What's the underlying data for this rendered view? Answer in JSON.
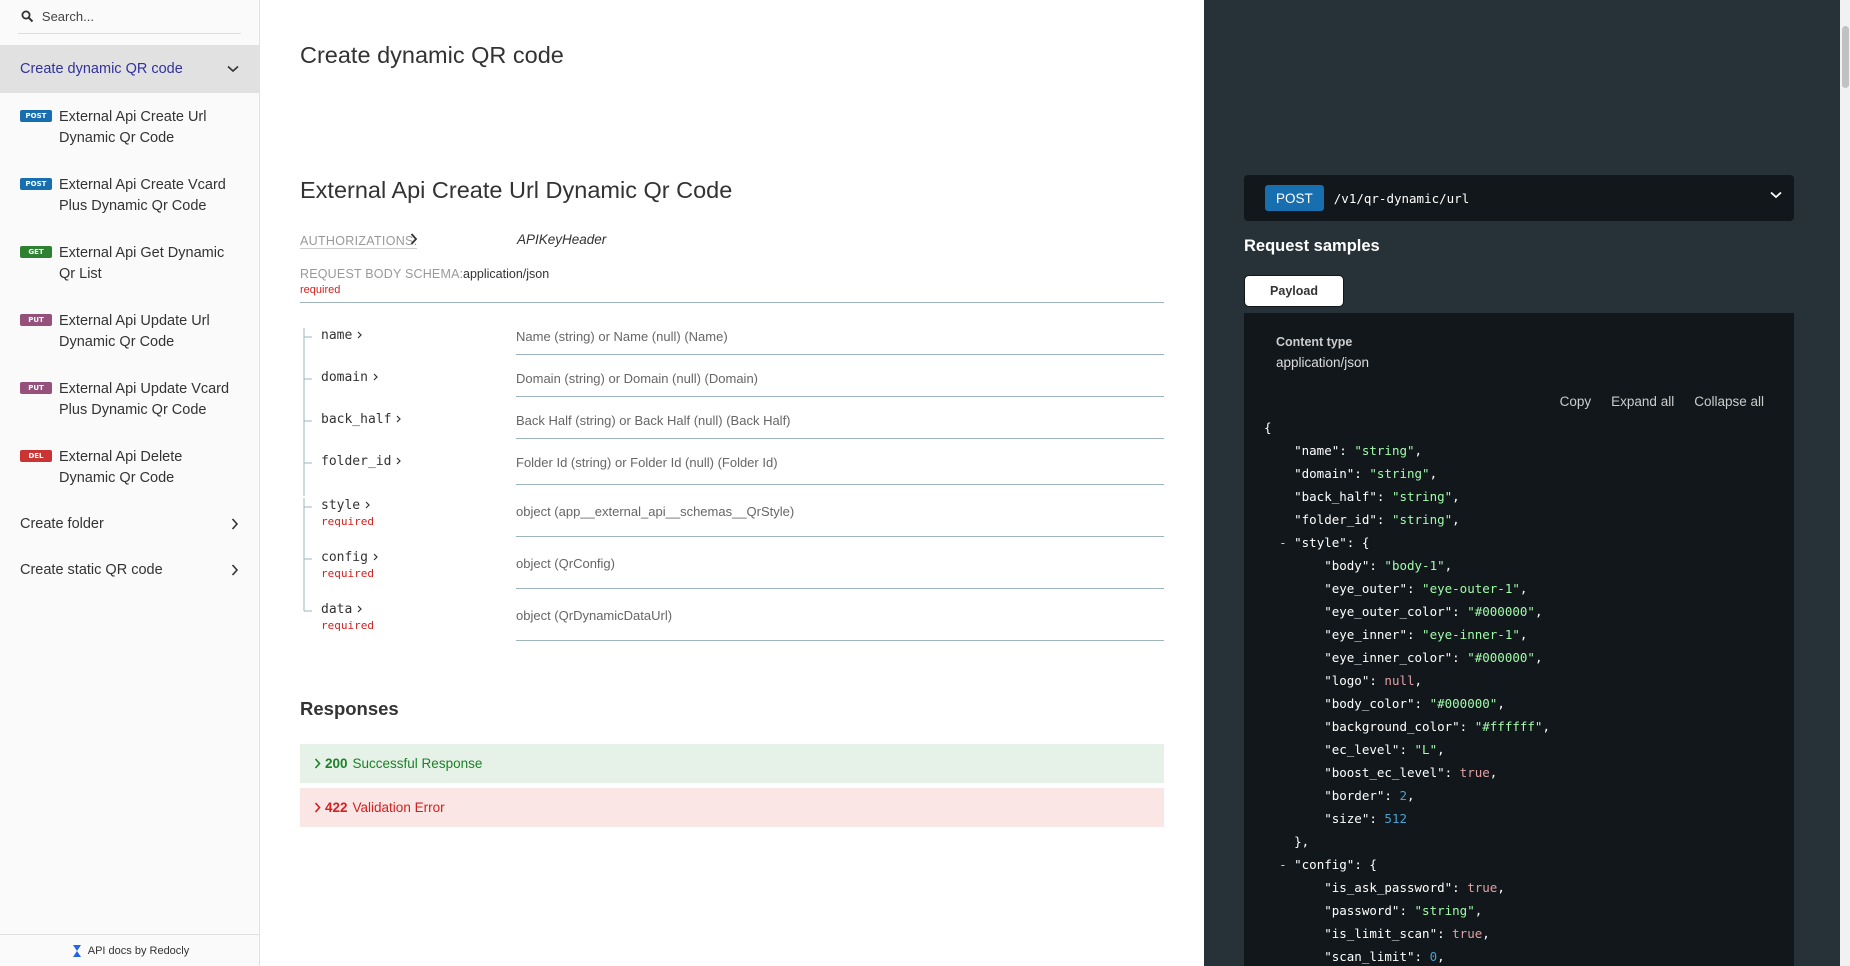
{
  "sidebar": {
    "search_placeholder": "Search...",
    "active_group": "Create dynamic QR code",
    "items": [
      {
        "method": "POST",
        "label": "External Api Create Url Dynamic Qr Code"
      },
      {
        "method": "POST",
        "label": "External Api Create Vcard Plus Dynamic Qr Code"
      },
      {
        "method": "GET",
        "label": "External Api Get Dynamic Qr List"
      },
      {
        "method": "PUT",
        "label": "External Api Update Url Dynamic Qr Code"
      },
      {
        "method": "PUT",
        "label": "External Api Update Vcard Plus Dynamic Qr Code"
      },
      {
        "method": "DEL",
        "label": "External Api Delete Dynamic Qr Code"
      }
    ],
    "groups": [
      "Create folder",
      "Create static QR code"
    ],
    "footer": "API docs by Redocly"
  },
  "main": {
    "section_title": "Create dynamic QR code",
    "op_title": "External Api Create Url Dynamic Qr Code",
    "authorizations_label": "AUTHORIZATIONS:",
    "authorizations_value": "APIKeyHeader",
    "schema_label": "REQUEST BODY SCHEMA:",
    "schema_type": "application/json",
    "schema_required": "required",
    "params": [
      {
        "name": "name",
        "desc": "Name (string) or Name (null) (Name)",
        "required": ""
      },
      {
        "name": "domain",
        "desc": "Domain (string) or Domain (null) (Domain)",
        "required": ""
      },
      {
        "name": "back_half",
        "desc": "Back Half (string) or Back Half (null) (Back Half)",
        "required": ""
      },
      {
        "name": "folder_id",
        "desc": "Folder Id (string) or Folder Id (null) (Folder Id)",
        "required": ""
      },
      {
        "name": "style",
        "desc": "object (app__external_api__schemas__QrStyle)",
        "required": "required"
      },
      {
        "name": "config",
        "desc": "object (QrConfig)",
        "required": "required"
      },
      {
        "name": "data",
        "desc": "object (QrDynamicDataUrl)",
        "required": "required"
      }
    ],
    "responses_title": "Responses",
    "responses": [
      {
        "code": "200",
        "label": "Successful Response"
      },
      {
        "code": "422",
        "label": "Validation Error"
      }
    ]
  },
  "panel": {
    "method": "POST",
    "path": "/v1/qr-dynamic/url",
    "request_samples": "Request samples",
    "payload_tab": "Payload",
    "content_type_label": "Content type",
    "content_type_value": "application/json",
    "actions": [
      "Copy",
      "Expand all",
      "Collapse all"
    ],
    "code_lines": [
      "{",
      "    \"name\": \"string\",",
      "    \"domain\": \"string\",",
      "    \"back_half\": \"string\",",
      "    \"folder_id\": \"string\",",
      "  - \"style\": {",
      "        \"body\": \"body-1\",",
      "        \"eye_outer\": \"eye-outer-1\",",
      "        \"eye_outer_color\": \"#000000\",",
      "        \"eye_inner\": \"eye-inner-1\",",
      "        \"eye_inner_color\": \"#000000\",",
      "        \"logo\": null,",
      "        \"body_color\": \"#000000\",",
      "        \"background_color\": \"#ffffff\",",
      "        \"ec_level\": \"L\",",
      "        \"boost_ec_level\": true,",
      "        \"border\": 2,",
      "        \"size\": 512",
      "    },",
      "  - \"config\": {",
      "        \"is_ask_password\": true,",
      "        \"password\": \"string\",",
      "        \"is_limit_scan\": true,",
      "        \"scan_limit\": 0,"
    ]
  },
  "colors": {
    "accent": "#32329f",
    "post": "#186faf",
    "get": "#2f8132",
    "put": "#95507c",
    "delete": "#cc3333",
    "success": "#1d8127",
    "error": "#d41f1c",
    "panel_bg": "#263238"
  }
}
